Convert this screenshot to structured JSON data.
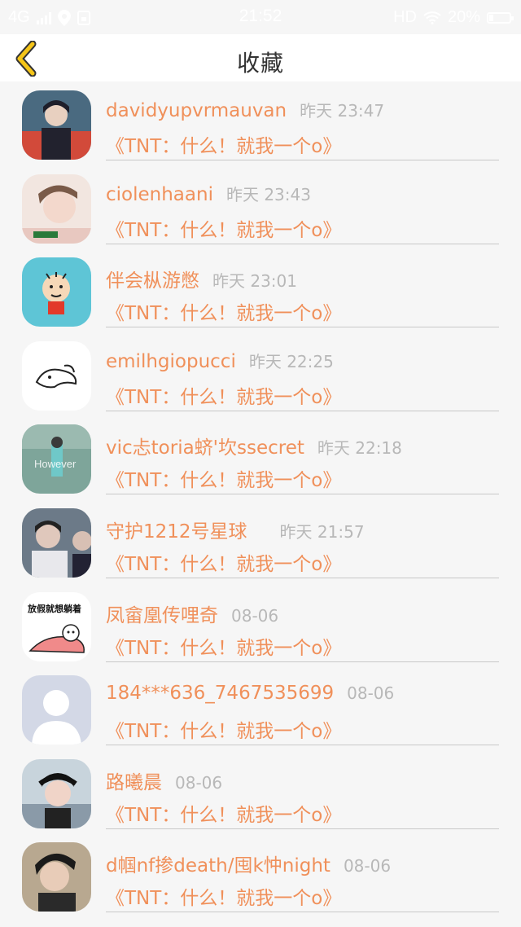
{
  "status_bar": {
    "network": "4G",
    "time": "21:52",
    "hd": "HD",
    "battery": "20%"
  },
  "nav": {
    "title": "收藏",
    "back_icon": "chevron-left-icon"
  },
  "colors": {
    "accent": "#f0905a",
    "back_icon": "#f5c518",
    "time_text": "#b8b8b8"
  },
  "items": [
    {
      "username": "davidyupvrmauvan",
      "time": "昨天 23:47",
      "title": "《TNT：什么！就我一个o》"
    },
    {
      "username": "ciolenhaani",
      "time": "昨天 23:43",
      "title": "《TNT：什么！就我一个o》"
    },
    {
      "username": "伴会枞游憋",
      "time": "昨天 23:01",
      "title": "《TNT：什么！就我一个o》"
    },
    {
      "username": "emilhgiopucci",
      "time": "昨天 22:25",
      "title": "《TNT：什么！就我一个o》"
    },
    {
      "username": "vic忐toria蛴'坎ssecret",
      "time": "昨天 22:18",
      "title": "《TNT：什么！就我一个o》",
      "avatar_text": "However"
    },
    {
      "username": "守护1212号星球",
      "time": "昨天 21:57",
      "title": "《TNT：什么！就我一个o》"
    },
    {
      "username": "凤畲凰传哩奇",
      "time": "08-06",
      "title": "《TNT：什么！就我一个o》",
      "avatar_text": "放假就想躺着"
    },
    {
      "username": "184***636_7467535699",
      "time": "08-06",
      "title": "《TNT：什么！就我一个o》"
    },
    {
      "username": "路曦晨",
      "time": "08-06",
      "title": "《TNT：什么！就我一个o》"
    },
    {
      "username": "d帼nf掺death/囤k忡night",
      "time": "08-06",
      "title": "《TNT：什么！就我一个o》"
    }
  ]
}
